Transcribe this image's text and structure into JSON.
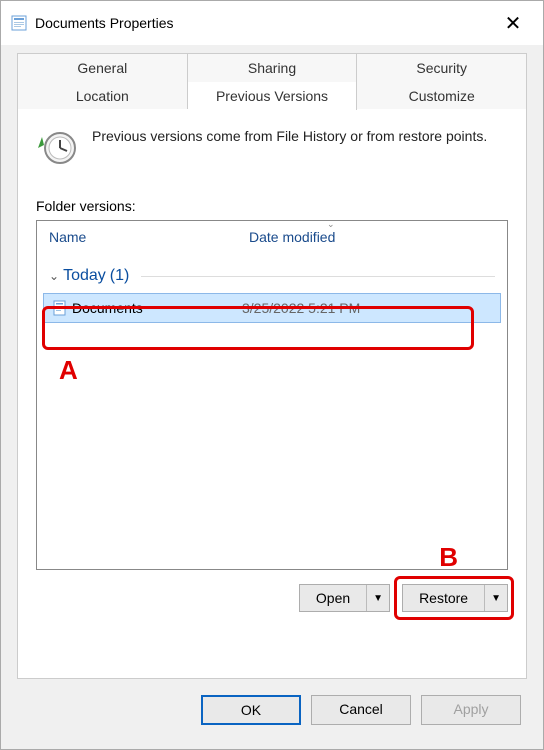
{
  "title": "Documents Properties",
  "tabs": {
    "row1": [
      "General",
      "Sharing",
      "Security"
    ],
    "row2": [
      "Location",
      "Previous Versions",
      "Customize"
    ],
    "active": "Previous Versions"
  },
  "info_text": "Previous versions come from File History or from restore points.",
  "section_label": "Folder versions:",
  "columns": {
    "name": "Name",
    "date": "Date modified"
  },
  "group": {
    "label": "Today",
    "count": "(1)"
  },
  "row": {
    "name": "Documents",
    "date": "3/25/2022 5:21 PM"
  },
  "callouts": {
    "a": "A",
    "b": "B"
  },
  "actions": {
    "open": "Open",
    "restore": "Restore"
  },
  "buttons": {
    "ok": "OK",
    "cancel": "Cancel",
    "apply": "Apply"
  }
}
